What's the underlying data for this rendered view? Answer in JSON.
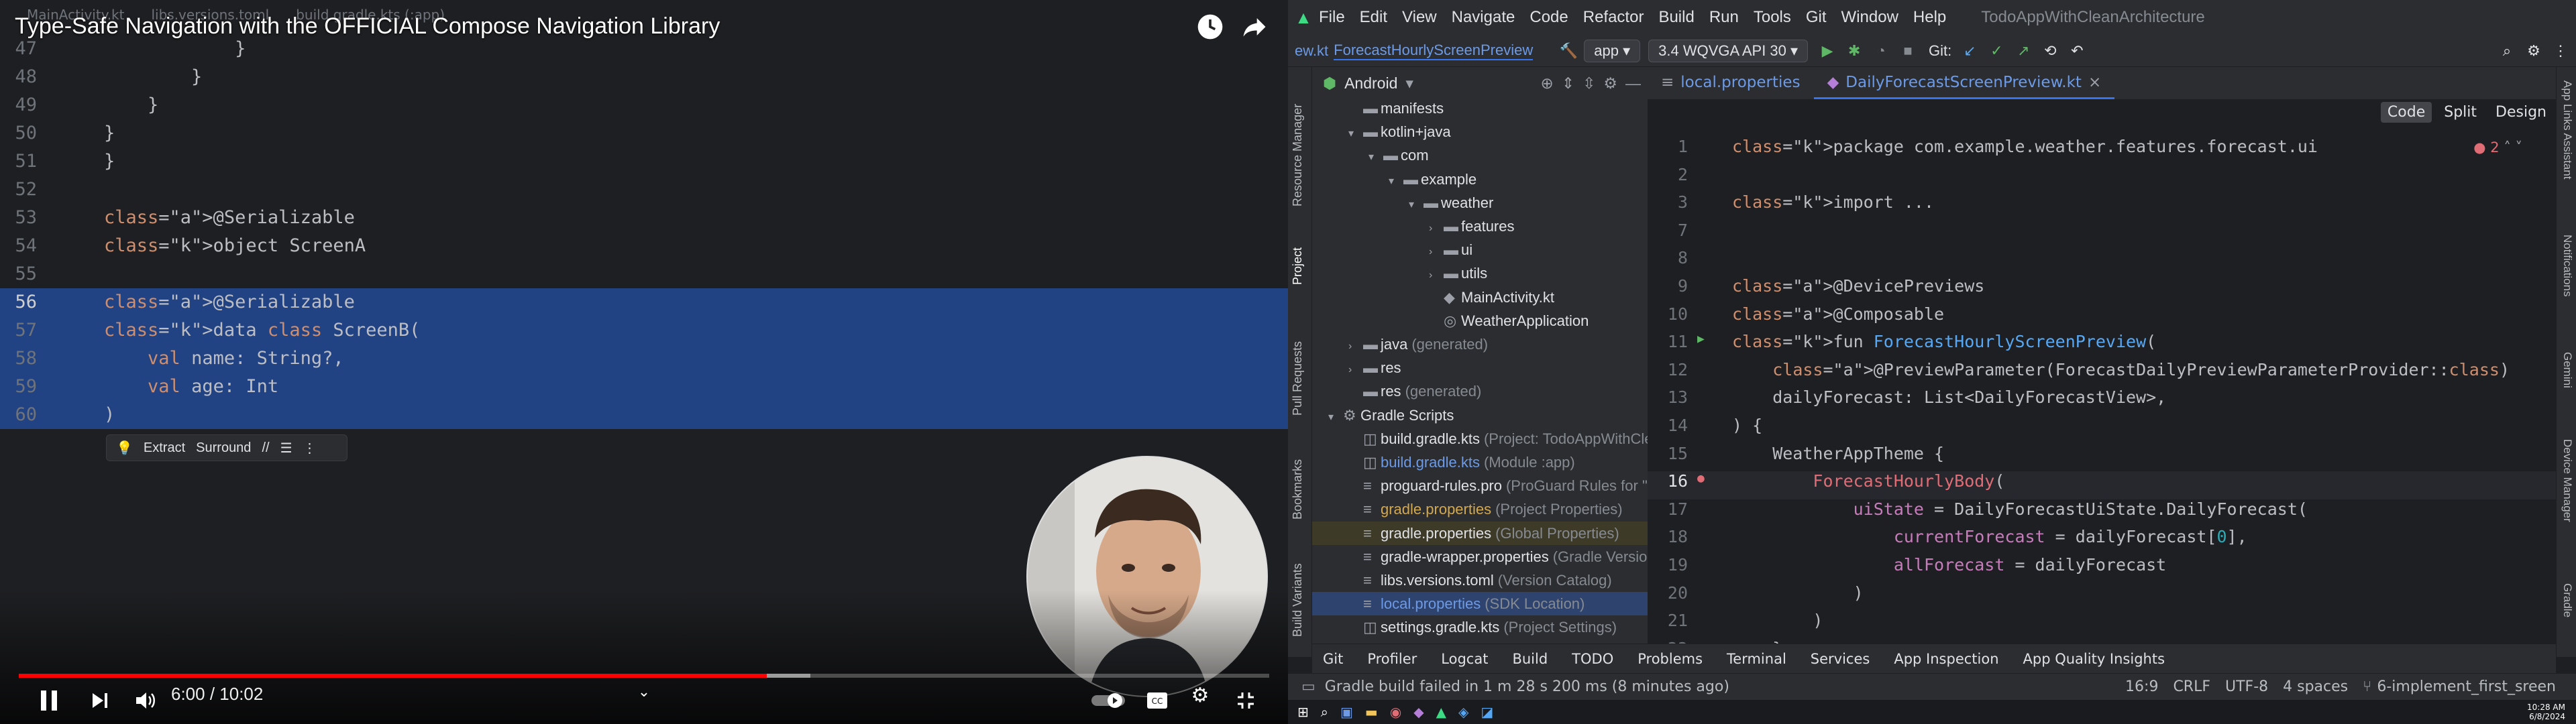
{
  "video": {
    "title": "Type-Safe Navigation with the OFFICIAL Compose Navigation Library",
    "time_current": "6:00",
    "time_total": "10:02",
    "time_sep": " / ",
    "progress": 0.598,
    "buffered": 0.633,
    "bg_tabs": [
      "MainActivity.kt",
      "libs.versions.toml",
      "build.gradle.kts (:app)"
    ],
    "intention": {
      "extract": "Extract",
      "surround": "Surround"
    },
    "code_lines": [
      {
        "n": "47",
        "t": "            }"
      },
      {
        "n": "48",
        "t": "        }"
      },
      {
        "n": "49",
        "t": "    }"
      },
      {
        "n": "50",
        "t": "}"
      },
      {
        "n": "51",
        "t": "}"
      },
      {
        "n": "52",
        "t": ""
      },
      {
        "n": "53",
        "t": "@Serializable"
      },
      {
        "n": "54",
        "t": "object ScreenA"
      },
      {
        "n": "55",
        "t": ""
      },
      {
        "n": "56",
        "t": "@Serializable"
      },
      {
        "n": "57",
        "t": "data class ScreenB("
      },
      {
        "n": "58",
        "t": "    val name: String?,"
      },
      {
        "n": "59",
        "t": "    val age: Int"
      },
      {
        "n": "60",
        "t": ")"
      }
    ]
  },
  "ide": {
    "menu": [
      "File",
      "Edit",
      "View",
      "Navigate",
      "Code",
      "Refactor",
      "Build",
      "Run",
      "Tools",
      "Git",
      "Window",
      "Help"
    ],
    "project_title": "TodoAppWithCleanArchitecture",
    "toolbar": {
      "breadcrumb_file": "ew.kt",
      "run_config": "ForecastHourlyScreenPreview",
      "module": "app",
      "device": "3.4  WQVGA API 30",
      "git_label": "Git:"
    },
    "project_panel": {
      "view": "Android"
    },
    "tree": [
      {
        "label": "manifests",
        "sub": ""
      },
      {
        "label": "kotlin+java",
        "sub": ""
      },
      {
        "label": "com",
        "sub": ""
      },
      {
        "label": "example",
        "sub": ""
      },
      {
        "label": "weather",
        "sub": ""
      },
      {
        "label": "features",
        "sub": ""
      },
      {
        "label": "ui",
        "sub": ""
      },
      {
        "label": "utils",
        "sub": ""
      },
      {
        "label": "MainActivity.kt",
        "sub": ""
      },
      {
        "label": "WeatherApplication",
        "sub": ""
      },
      {
        "label": "java",
        "sub": "(generated)"
      },
      {
        "label": "res",
        "sub": ""
      },
      {
        "label": "res",
        "sub": "(generated)"
      },
      {
        "label": "Gradle Scripts",
        "sub": ""
      },
      {
        "label": "build.gradle.kts",
        "sub": "(Project: TodoAppWithCleanArchi"
      },
      {
        "label": "build.gradle.kts",
        "sub": "(Module :app)"
      },
      {
        "label": "proguard-rules.pro",
        "sub": "(ProGuard Rules for \":app\")"
      },
      {
        "label": "gradle.properties",
        "sub": "(Project Properties)"
      },
      {
        "label": "gradle.properties",
        "sub": "(Global Properties)"
      },
      {
        "label": "gradle-wrapper.properties",
        "sub": "(Gradle Version)"
      },
      {
        "label": "libs.versions.toml",
        "sub": "(Version Catalog)"
      },
      {
        "label": "local.properties",
        "sub": "(SDK Location)"
      },
      {
        "label": "settings.gradle.kts",
        "sub": "(Project Settings)"
      }
    ],
    "editor_tabs": [
      "local.properties",
      "DailyForecastScreenPreview.kt"
    ],
    "modes": [
      "Code",
      "Split",
      "Design"
    ],
    "problems": "2",
    "left_tools": [
      "Resource Manager",
      "Project",
      "Pull Requests",
      "Bookmarks",
      "Build Variants"
    ],
    "right_tools": [
      "App Links Assistant",
      "Notifications",
      "Gemini",
      "Device Manager",
      "Gradle"
    ],
    "code": [
      {
        "n": "1",
        "t": "package com.example.weather.features.forecast.ui"
      },
      {
        "n": "2",
        "t": ""
      },
      {
        "n": "3",
        "t": "import ..."
      },
      {
        "n": "7",
        "t": ""
      },
      {
        "n": "8",
        "t": ""
      },
      {
        "n": "9",
        "t": "@DevicePreviews"
      },
      {
        "n": "10",
        "t": "@Composable"
      },
      {
        "n": "11",
        "t": "fun ForecastHourlyScreenPreview("
      },
      {
        "n": "12",
        "t": "    @PreviewParameter(ForecastDailyPreviewParameterProvider::class)"
      },
      {
        "n": "13",
        "t": "    dailyForecast: List<DailyForecastView>,"
      },
      {
        "n": "14",
        "t": ") {"
      },
      {
        "n": "15",
        "t": "    WeatherAppTheme {"
      },
      {
        "n": "16",
        "t": "        ForecastHourlyBody("
      },
      {
        "n": "17",
        "t": "            uiState = DailyForecastUiState.DailyForecast("
      },
      {
        "n": "18",
        "t": "                currentForecast = dailyForecast[0],"
      },
      {
        "n": "19",
        "t": "                allForecast = dailyForecast"
      },
      {
        "n": "20",
        "t": "            )"
      },
      {
        "n": "21",
        "t": "        )"
      },
      {
        "n": "22",
        "t": "    }"
      }
    ],
    "bottom_tools": [
      "Git",
      "Profiler",
      "Logcat",
      "Build",
      "TODO",
      "Problems",
      "Terminal",
      "Services",
      "App Inspection",
      "App Quality Insights"
    ],
    "status": {
      "message": "Gradle build failed in 1 m 28 s 200 ms (8 minutes ago)",
      "pos": "16:9",
      "eol": "CRLF",
      "enc": "UTF-8",
      "indent": "4 spaces",
      "branch": "6-implement_first_sreen"
    },
    "clock": {
      "time": "10:28 AM",
      "date": "6/8/2024"
    }
  }
}
